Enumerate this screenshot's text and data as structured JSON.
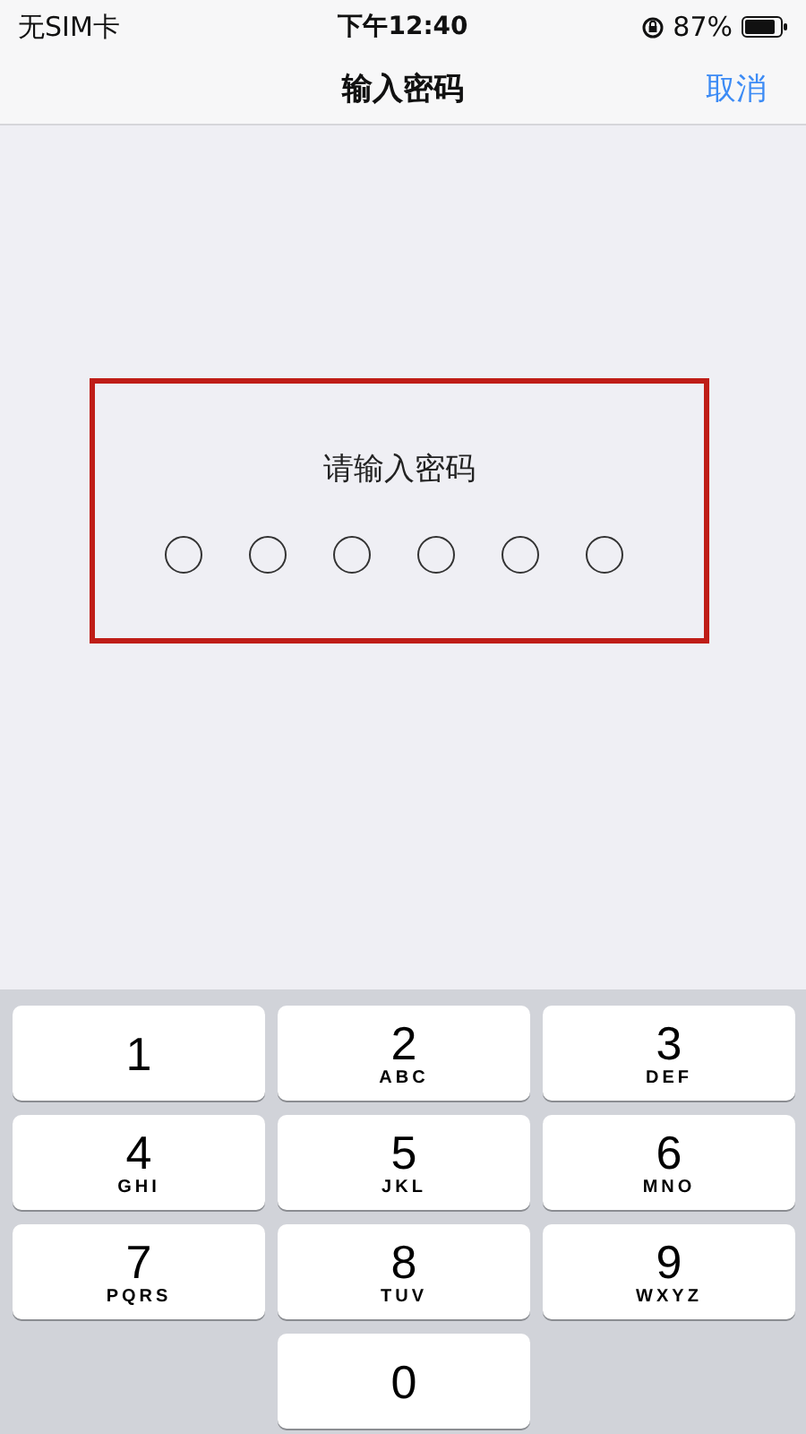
{
  "status_bar": {
    "carrier": "无SIM卡",
    "time": "下午12:40",
    "battery": "87%"
  },
  "nav": {
    "title": "输入密码",
    "cancel": "取消"
  },
  "prompt": {
    "label": "请输入密码",
    "highlighted": true,
    "dots": [
      {
        "filled": false
      },
      {
        "filled": false
      },
      {
        "filled": false
      },
      {
        "filled": false
      },
      {
        "filled": false
      },
      {
        "filled": false
      }
    ]
  },
  "keypad": [
    {
      "digit": "1"
    },
    {
      "digit": "2",
      "letters": "ABC"
    },
    {
      "digit": "3",
      "letters": "DEF"
    },
    {
      "digit": "4",
      "letters": "GHI"
    },
    {
      "digit": "5",
      "letters": "JKL"
    },
    {
      "digit": "6",
      "letters": "MNO"
    },
    {
      "digit": "7",
      "letters": "PQRS"
    },
    {
      "digit": "8",
      "letters": "TUV"
    },
    {
      "digit": "9",
      "letters": "WXYZ"
    },
    {
      "digit": "0"
    }
  ]
}
